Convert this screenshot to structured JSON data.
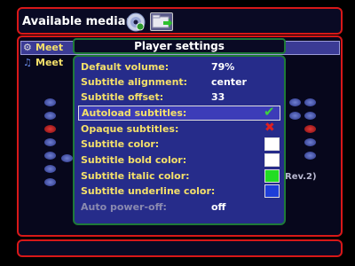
{
  "top_bar": {
    "title": "Available media:"
  },
  "file_list": [
    {
      "label": "Meet"
    },
    {
      "label": "Meet"
    }
  ],
  "background_text": "Rev.2)",
  "settings": {
    "title": "Player settings",
    "rows": [
      {
        "label": "Default volume:",
        "value": "79%"
      },
      {
        "label": "Subtitle alignment:",
        "value": "center"
      },
      {
        "label": "Subtitle offset:",
        "value": "33"
      },
      {
        "label": "Autoload subtitles:",
        "value": "checked"
      },
      {
        "label": "Opaque subtitles:",
        "value": "unchecked"
      },
      {
        "label": "Subtitle color:",
        "color": "#ffffff"
      },
      {
        "label": "Subtitle bold color:",
        "color": "#ffffff"
      },
      {
        "label": "Subtitle italic color:",
        "color": "#22dd22"
      },
      {
        "label": "Subtitle underline color:",
        "color": "#1e3ed8"
      },
      {
        "label": "Auto power-off:",
        "value": "off"
      }
    ]
  },
  "icons": {
    "disc": "disc-icon",
    "folder": "folder-icon",
    "check": "checkmark-icon",
    "cross": "cross-icon"
  }
}
